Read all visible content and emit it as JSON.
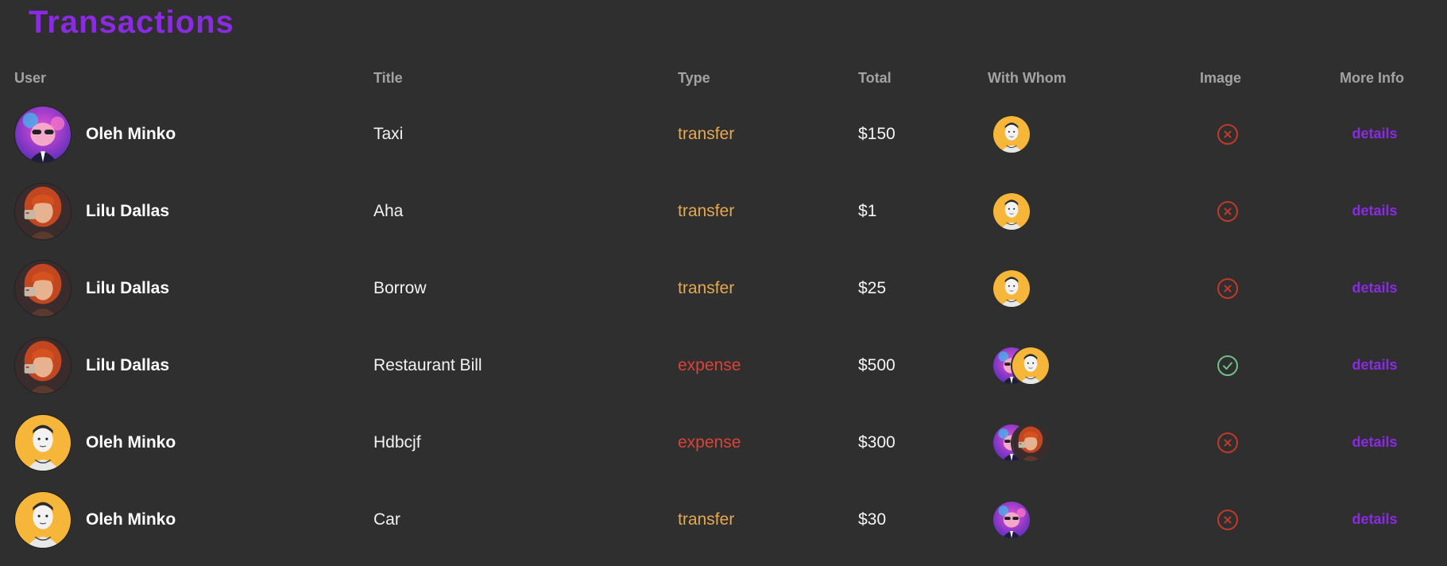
{
  "page": {
    "title": "Transactions"
  },
  "table": {
    "headers": {
      "user": "User",
      "title": "Title",
      "type": "Type",
      "total": "Total",
      "with_whom": "With Whom",
      "image": "Image",
      "more_info": "More Info"
    },
    "rows": [
      {
        "user_name": "Oleh Minko",
        "user_avatar": "purple-cartoon-avatar",
        "title": "Taxi",
        "type": "transfer",
        "total": "$150",
        "with_whom": [
          "yellow-portrait-avatar"
        ],
        "image_status": "missing",
        "details_label": "details"
      },
      {
        "user_name": "Lilu Dallas",
        "user_avatar": "red-hair-avatar",
        "title": "Aha",
        "type": "transfer",
        "total": "$1",
        "with_whom": [
          "yellow-portrait-avatar"
        ],
        "image_status": "missing",
        "details_label": "details"
      },
      {
        "user_name": "Lilu Dallas",
        "user_avatar": "red-hair-avatar",
        "title": "Borrow",
        "type": "transfer",
        "total": "$25",
        "with_whom": [
          "yellow-portrait-avatar"
        ],
        "image_status": "missing",
        "details_label": "details"
      },
      {
        "user_name": "Lilu Dallas",
        "user_avatar": "red-hair-avatar",
        "title": "Restaurant Bill",
        "type": "expense",
        "total": "$500",
        "with_whom": [
          "purple-cartoon-avatar",
          "yellow-portrait-avatar"
        ],
        "image_status": "attached",
        "details_label": "details"
      },
      {
        "user_name": "Oleh Minko",
        "user_avatar": "yellow-portrait-avatar",
        "title": "Hdbcjf",
        "type": "expense",
        "total": "$300",
        "with_whom": [
          "purple-cartoon-avatar",
          "red-hair-avatar"
        ],
        "image_status": "missing",
        "details_label": "details"
      },
      {
        "user_name": "Oleh Minko",
        "user_avatar": "yellow-portrait-avatar",
        "title": "Car",
        "type": "transfer",
        "total": "$30",
        "with_whom": [
          "purple-cartoon-avatar"
        ],
        "image_status": "missing",
        "details_label": "details"
      }
    ]
  },
  "colors": {
    "background": "#2f2f2f",
    "accent": "#8a2be2",
    "transfer": "#e5a84f",
    "expense": "#d9433a",
    "missing": "#c0392b",
    "attached": "#6fbf8a",
    "header": "#a3a3a3"
  }
}
